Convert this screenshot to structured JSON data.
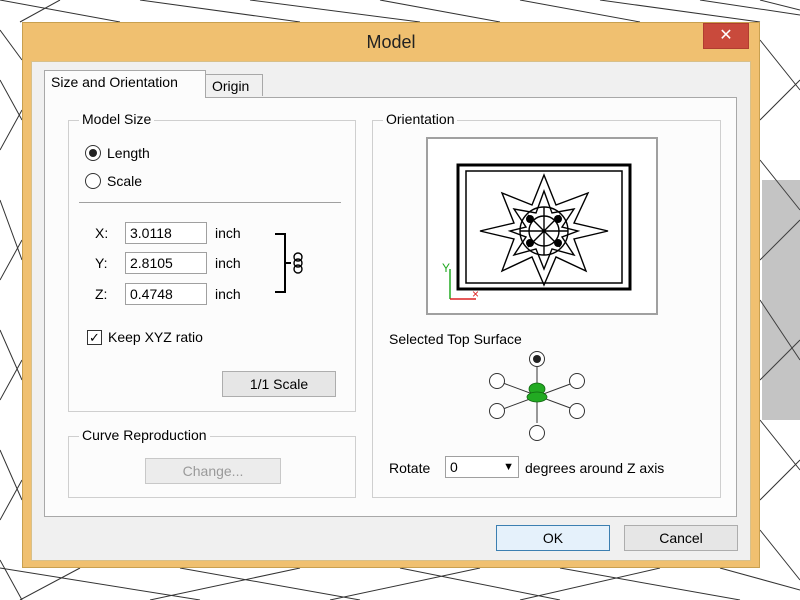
{
  "dialog": {
    "title": "Model",
    "close_glyph": "✕",
    "tabs": [
      {
        "label": "Size and Orientation",
        "active": true
      },
      {
        "label": "Origin",
        "active": false
      }
    ]
  },
  "model_size": {
    "label": "Model Size",
    "options": [
      {
        "label": "Length",
        "selected": true
      },
      {
        "label": "Scale",
        "selected": false
      }
    ],
    "axes": [
      {
        "axis": "X:",
        "value": "3.0118",
        "unit": "inch"
      },
      {
        "axis": "Y:",
        "value": "2.8105",
        "unit": "inch"
      },
      {
        "axis": "Z:",
        "value": "0.4748",
        "unit": "inch"
      }
    ],
    "link_icon": "chain-link-icon",
    "keep_ratio_label": "Keep XYZ ratio",
    "keep_ratio_checked": true,
    "scale_button": "1/1 Scale"
  },
  "curve_reproduction": {
    "label": "Curve Reproduction",
    "change_button": "Change..."
  },
  "orientation": {
    "label": "Orientation",
    "selected_top_surface_label": "Selected Top Surface",
    "axis_y": "Y",
    "rotate_label": "Rotate",
    "rotate_value": "0",
    "rotate_suffix": "degrees around Z axis"
  },
  "footer": {
    "ok": "OK",
    "cancel": "Cancel"
  },
  "colors": {
    "title_bar": "#f0c070",
    "close": "#c94a3c",
    "model_green": "#22aa22"
  }
}
